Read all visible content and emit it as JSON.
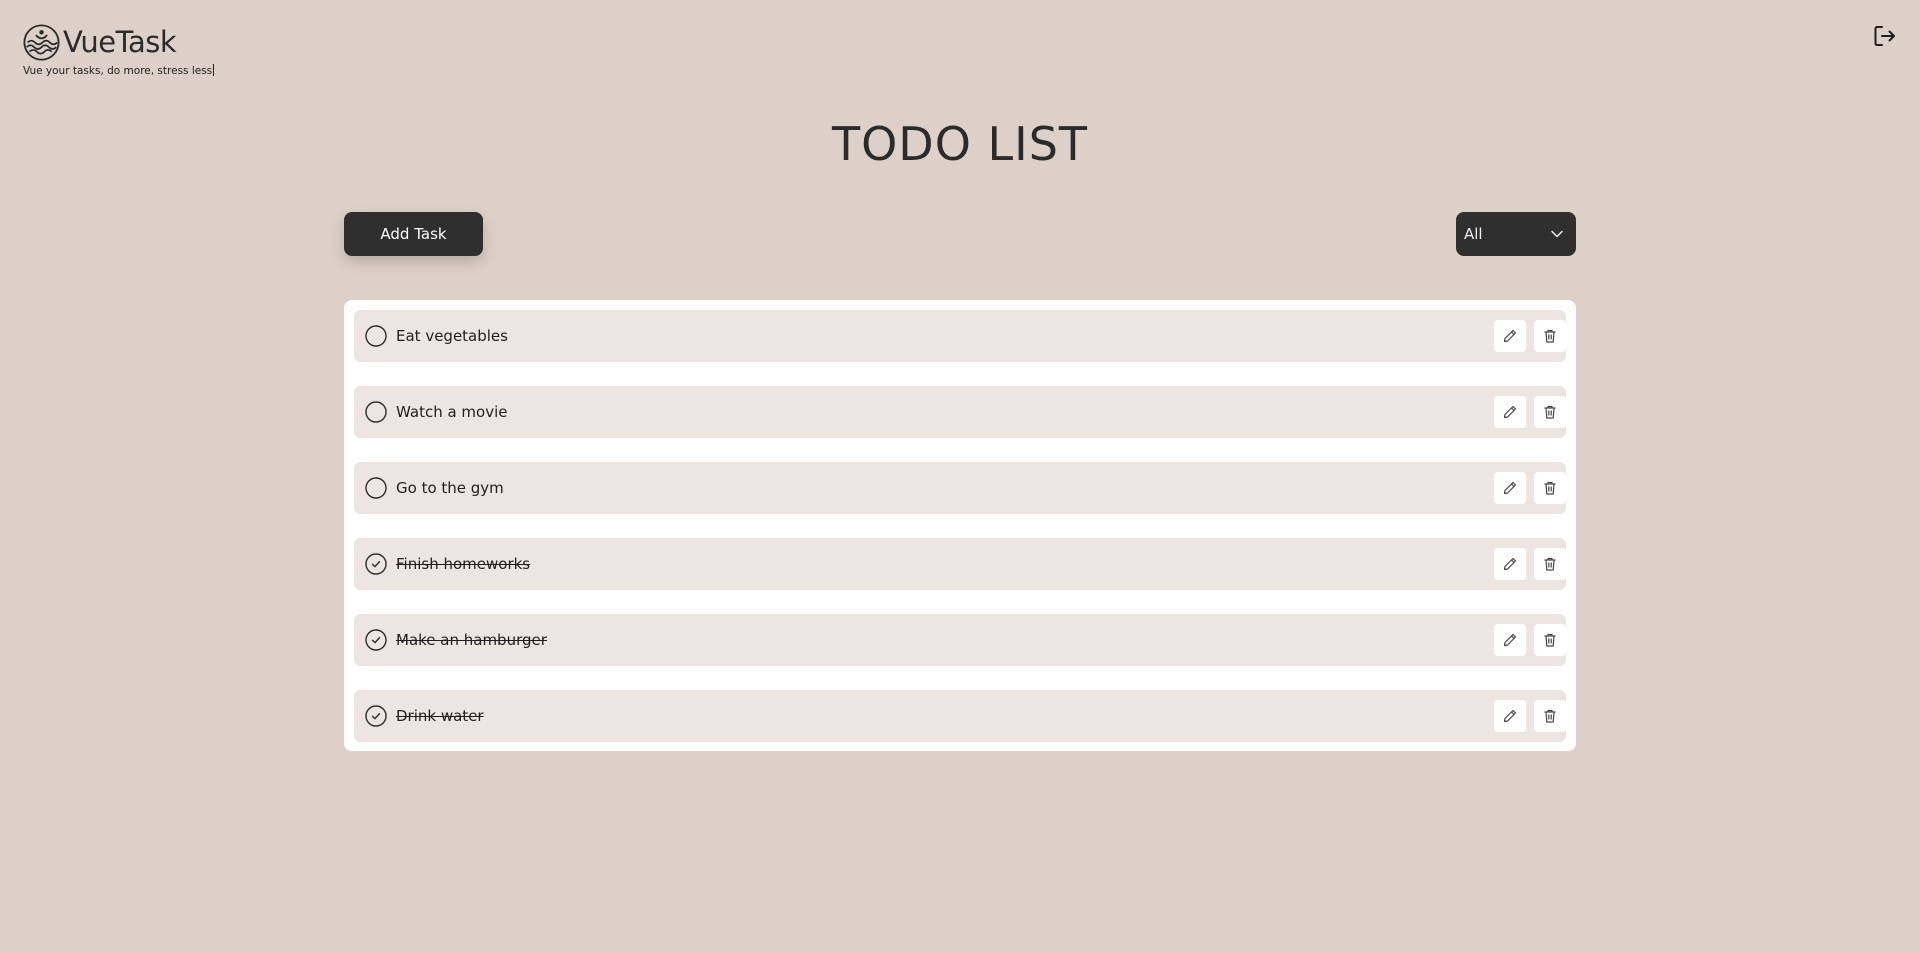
{
  "brand": {
    "name": "VueTask",
    "tagline": "Vue your tasks, do more, stress less"
  },
  "header": {
    "logout_icon": "logout-icon"
  },
  "page": {
    "title": "TODO LIST"
  },
  "controls": {
    "add_task_label": "Add Task",
    "filter_selected": "All"
  },
  "todos": [
    {
      "text": "Eat vegetables",
      "completed": false
    },
    {
      "text": "Watch a movie",
      "completed": false
    },
    {
      "text": "Go to the gym",
      "completed": false
    },
    {
      "text": "Finish homeworks",
      "completed": true
    },
    {
      "text": "Make an hamburger",
      "completed": true
    },
    {
      "text": "Drink water",
      "completed": true
    }
  ],
  "icons": {
    "row_edit": "pencil-icon",
    "row_delete": "trash-icon",
    "unchecked": "circle-icon",
    "checked": "check-circle-icon",
    "filter_arrow": "chevron-down-icon"
  },
  "colors": {
    "background": "#ddd0c8",
    "dark_button": "#2f2f2f",
    "panel": "#ffffff",
    "row": "#ede5e2",
    "text": "#2b2b2b"
  }
}
